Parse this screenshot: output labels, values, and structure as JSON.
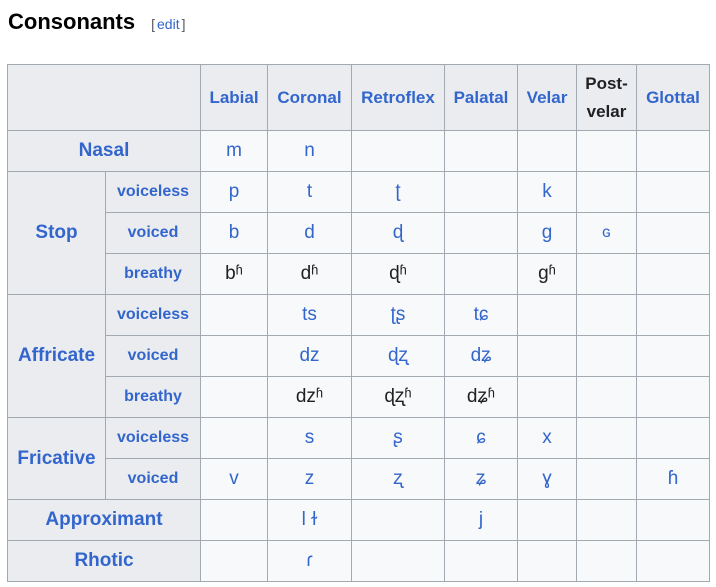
{
  "section": {
    "title": "Consonants",
    "edit_open": "[",
    "edit_label": "edit",
    "edit_close": "]"
  },
  "table": {
    "columns": [
      "Labial",
      "Coronal",
      "Retroflex",
      "Palatal",
      "Velar",
      "Post-velar",
      "Glottal"
    ],
    "rows": {
      "nasal": {
        "label": "Nasal",
        "cells": [
          "m",
          "n",
          "",
          "",
          "",
          "",
          ""
        ]
      },
      "stop": {
        "label": "Stop",
        "voiceless": {
          "label": "voiceless",
          "cells": [
            "p",
            "t",
            "ʈ",
            "",
            "k",
            "",
            ""
          ]
        },
        "voiced": {
          "label": "voiced",
          "cells": [
            "b",
            "d",
            "ɖ",
            "",
            "ɡ",
            "ɢ",
            ""
          ]
        },
        "breathy": {
          "label": "breathy",
          "cells": [
            "bʱ",
            "dʱ",
            "ɖʱ",
            "",
            "ɡʱ",
            "",
            ""
          ]
        }
      },
      "affricate": {
        "label": "Affricate",
        "voiceless": {
          "label": "voiceless",
          "cells": [
            "",
            "ts",
            "ʈʂ",
            "tɕ",
            "",
            "",
            ""
          ]
        },
        "voiced": {
          "label": "voiced",
          "cells": [
            "",
            "dz",
            "ɖʐ",
            "dʑ",
            "",
            "",
            ""
          ]
        },
        "breathy": {
          "label": "breathy",
          "cells": [
            "",
            "dzʱ",
            "ɖʐʱ",
            "dʑʱ",
            "",
            "",
            ""
          ]
        }
      },
      "fricative": {
        "label": "Fricative",
        "voiceless": {
          "label": "voiceless",
          "cells": [
            "",
            "s",
            "ʂ",
            "ɕ",
            "x",
            "",
            ""
          ]
        },
        "voiced": {
          "label": "voiced",
          "cells": [
            "v",
            "z",
            "ʐ",
            "ʑ",
            "ɣ",
            "",
            "ɦ"
          ]
        }
      },
      "approximant": {
        "label": "Approximant",
        "cells": [
          "",
          "l ɫ",
          "",
          "j",
          "",
          "",
          ""
        ]
      },
      "rhotic": {
        "label": "Rhotic",
        "cells": [
          "",
          "ɾ",
          "",
          "",
          "",
          "",
          ""
        ]
      }
    }
  },
  "colors": {
    "link": "#3366cc",
    "header_bg": "#eaecf0",
    "cell_bg": "#f8f9fa",
    "border": "#a2a9b1"
  }
}
